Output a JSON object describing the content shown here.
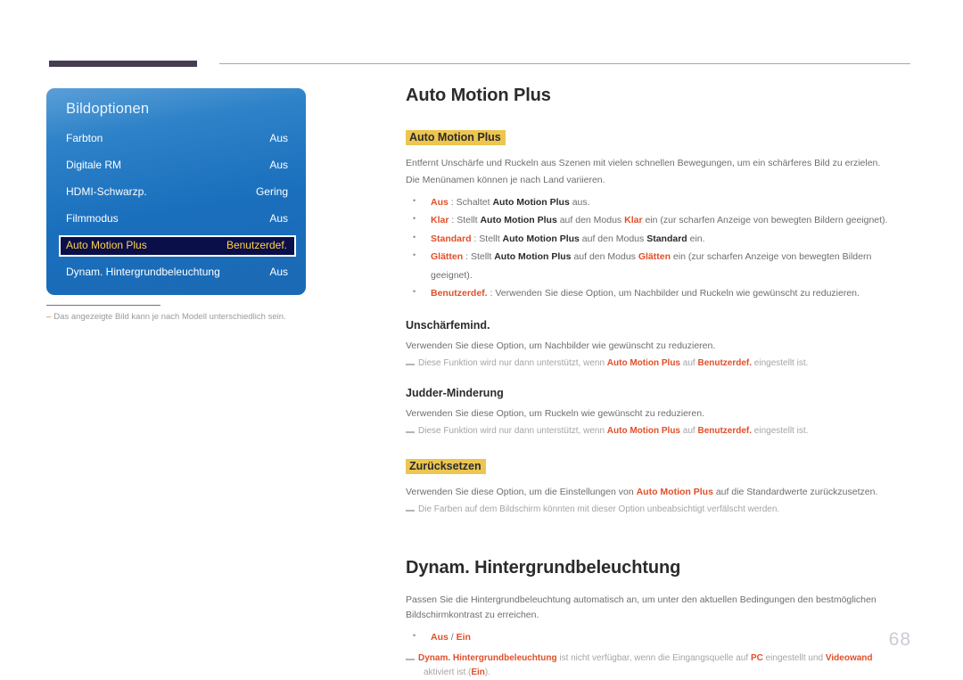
{
  "page": {
    "number": "68"
  },
  "colors": {
    "accent_orange": "#e0502a",
    "highlight_gold": "#ecc651",
    "osd_blue": "#1a6fbd",
    "osd_selected_bg": "#0a0f4a",
    "osd_selected_text": "#ffd24a",
    "header_bar": "#473d52",
    "body_text": "#6e6e6e",
    "page_number": "#c9ccd6"
  },
  "osd": {
    "title": "Bildoptionen",
    "rows": [
      {
        "label": "Farbton",
        "value": "Aus",
        "selected": false
      },
      {
        "label": "Digitale RM",
        "value": "Aus",
        "selected": false
      },
      {
        "label": "HDMI-Schwarzp.",
        "value": "Gering",
        "selected": false
      },
      {
        "label": "Filmmodus",
        "value": "Aus",
        "selected": false
      },
      {
        "label": "Auto Motion Plus",
        "value": "Benutzerdef.",
        "selected": true
      },
      {
        "label": "Dynam. Hintergrundbeleuchtung",
        "value": "Aus",
        "selected": false
      }
    ],
    "caption_dash": "–",
    "caption": "Das angezeigte Bild kann je nach Modell unterschiedlich sein."
  },
  "content": {
    "heading_1": "Auto Motion Plus",
    "subheading_1": "Auto Motion Plus",
    "intro_line_1": "Entfernt Unschärfe und Ruckeln aus Szenen mit vielen schnellen Bewegungen, um ein schärferes Bild zu erzielen.",
    "intro_line_2": "Die Menünamen können je nach Land variieren.",
    "options": [
      {
        "name": "Aus",
        "sep": " : ",
        "text_before": "Schaltet ",
        "inline_bold": "Auto Motion Plus",
        "text_after": " aus."
      },
      {
        "name": "Klar",
        "sep": " : ",
        "text_before": "Stellt ",
        "inline_bold": "Auto Motion Plus",
        "text_mid": " auf den Modus ",
        "mode": "Klar",
        "text_after": " ein (zur scharfen Anzeige von bewegten Bildern geeignet)."
      },
      {
        "name": "Standard",
        "sep": " : ",
        "text_before": "Stellt ",
        "inline_bold": "Auto Motion Plus",
        "text_mid": " auf den Modus ",
        "mode": "Standard",
        "text_after": " ein."
      },
      {
        "name": "Glätten",
        "sep": " : ",
        "text_before": "Stellt ",
        "inline_bold": "Auto Motion Plus",
        "text_mid": " auf den Modus ",
        "mode": "Glätten",
        "text_after": " ein (zur scharfen Anzeige von bewegten Bildern geeignet)."
      },
      {
        "name": "Benutzerdef.",
        "sep": " : ",
        "text_before": "Verwenden Sie diese Option, um Nachbilder und Ruckeln wie gewünscht zu reduzieren."
      }
    ],
    "unschaerfemind": {
      "heading": "Unschärfemind.",
      "body": "Verwenden Sie diese Option, um Nachbilder wie gewünscht zu reduzieren.",
      "note_before": "Diese Funktion wird nur dann unterstützt, wenn ",
      "note_term_1": "Auto Motion Plus",
      "note_mid": " auf ",
      "note_term_2": "Benutzerdef.",
      "note_after": " eingestellt ist."
    },
    "judder": {
      "heading": "Judder-Minderung",
      "body": "Verwenden Sie diese Option, um Ruckeln wie gewünscht zu reduzieren.",
      "note_before": "Diese Funktion wird nur dann unterstützt, wenn ",
      "note_term_1": "Auto Motion Plus",
      "note_mid": " auf ",
      "note_term_2": "Benutzerdef.",
      "note_after": " eingestellt ist."
    },
    "zuruecksetzen": {
      "subheading": "Zurücksetzen",
      "body_before": "Verwenden Sie diese Option, um die Einstellungen von ",
      "body_term": "Auto Motion Plus",
      "body_after": " auf die Standardwerte zurückzusetzen.",
      "note": "Die Farben auf dem Bildschirm könnten mit dieser Option unbeabsichtigt verfälscht werden."
    },
    "heading_2": "Dynam. Hintergrundbeleuchtung",
    "dynam": {
      "body_line_1": "Passen Sie die Hintergrundbeleuchtung automatisch an, um unter den aktuellen Bedingungen den bestmöglichen",
      "body_line_2": "Bildschirmkontrast zu erreichen.",
      "option_a": "Aus",
      "option_sep": " / ",
      "option_b": "Ein",
      "note_term_1": "Dynam. Hintergrundbeleuchtung",
      "note_mid_1": " ist nicht verfügbar, wenn die Eingangsquelle auf ",
      "note_term_2": "PC",
      "note_mid_2": " eingestellt und ",
      "note_term_3": "Videowand",
      "note_line2_before": "aktiviert ist (",
      "note_term_4": "Ein",
      "note_line2_after": ")."
    }
  }
}
